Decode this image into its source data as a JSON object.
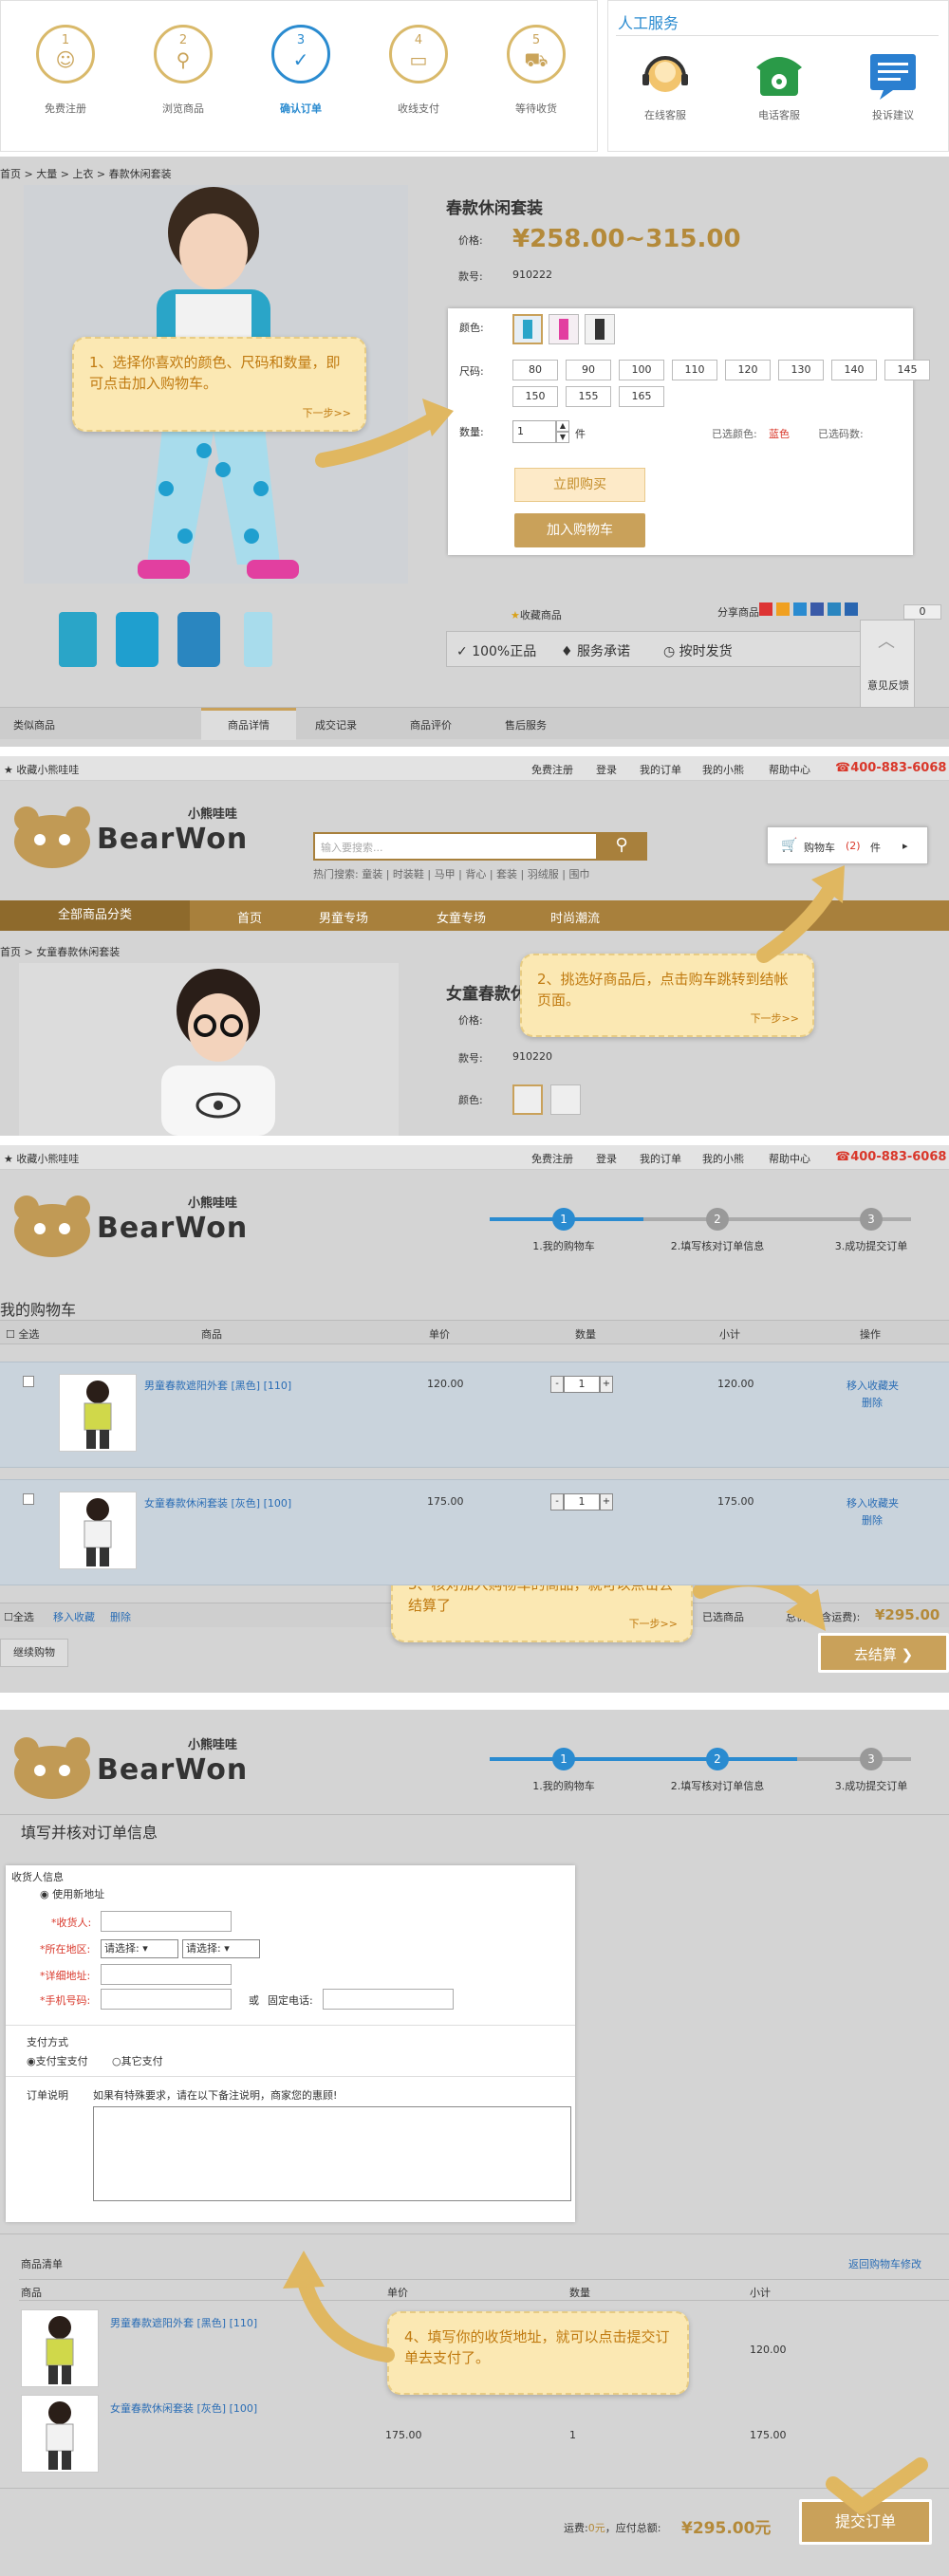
{
  "steps": [
    {
      "num": "1",
      "label": "免费注册"
    },
    {
      "num": "2",
      "label": "浏览商品"
    },
    {
      "num": "3",
      "label": "确认订单"
    },
    {
      "num": "4",
      "label": "收线支付"
    },
    {
      "num": "5",
      "label": "等待收货"
    }
  ],
  "service": {
    "title": "人工服务",
    "items": [
      "在线客服",
      "电话客服",
      "投诉建议"
    ]
  },
  "p1": {
    "breadcrumb": [
      "首页",
      "大量",
      "上衣",
      "春款休闲套装"
    ],
    "product_title": "春款休闲套装",
    "price_label": "价格:",
    "price": "¥258.00~315.00",
    "sku_label": "款号:",
    "sku": "910222",
    "color_label": "颜色:",
    "size_label": "尺码:",
    "sizes": [
      "80",
      "90",
      "100",
      "110",
      "120",
      "130",
      "140",
      "145",
      "150",
      "155",
      "165"
    ],
    "qty_label": "数量:",
    "qty": "1",
    "unit": "件",
    "chosen_color_label": "已选颜色:",
    "chosen_color": "蓝色",
    "chosen_size_label": "已选码数:",
    "buy_now": "立即购买",
    "add_cart": "加入购物车",
    "favorite": "收藏商品",
    "share": "分享商品",
    "share_count": "0",
    "guarantees": [
      "100%正品",
      "服务承诺",
      "按时发货"
    ],
    "feedback": "意见反馈",
    "tabs": [
      "类似商品",
      "商品详情",
      "成交记录",
      "商品评价",
      "售后服务"
    ],
    "note": "1、选择你喜欢的颜色、尺码和数量，即可点击加入购物车。",
    "note_next": "下一步>>"
  },
  "p2": {
    "topbar_left": "收藏小熊哇哇",
    "topbar_links": [
      "免费注册",
      "登录",
      "我的订单",
      "我的小熊",
      "帮助中心"
    ],
    "phone": "400-883-6068",
    "logo_cn": "小熊哇哇",
    "logo_en": "BearWon",
    "search_placeholder": "输入要搜索...",
    "hot_label": "热门搜索:",
    "hot": [
      "童装",
      "时装鞋",
      "马甲",
      "背心",
      "套装",
      "羽绒服",
      "围巾"
    ],
    "cart_label": "购物车",
    "cart_count": "(2)",
    "cart_unit": "件",
    "nav": [
      "全部商品分类",
      "首页",
      "男童专场",
      "女童专场",
      "时尚潮流"
    ],
    "breadcrumb": [
      "首页",
      "女童春款休闲套装"
    ],
    "product_title": "女童春款休闲套装",
    "price_label": "价格:",
    "sku_label": "款号:",
    "sku": "910220",
    "color_label": "颜色:",
    "note": "2、挑选好商品后，点击购车跳转到结帐页面。",
    "note_next": "下一步>>"
  },
  "p3": {
    "topbar_left": "收藏小熊哇哇",
    "topbar_links": [
      "免费注册",
      "登录",
      "我的订单",
      "我的小熊",
      "帮助中心"
    ],
    "phone": "400-883-6068",
    "progress": [
      {
        "num": "1",
        "label": "1.我的购物车"
      },
      {
        "num": "2",
        "label": "2.填写核对订单信息"
      },
      {
        "num": "3",
        "label": "3.成功提交订单"
      }
    ],
    "title": "我的购物车",
    "headers": [
      "全选",
      "商品",
      "单价",
      "数量",
      "小计",
      "操作"
    ],
    "items": [
      {
        "name": "男童春款遮阳外套 [黑色] [110]",
        "price": "120.00",
        "qty": "1",
        "subtotal": "120.00",
        "ops": [
          "移入收藏夹",
          "删除"
        ]
      },
      {
        "name": "女童春款休闲套装 [灰色] [100]",
        "price": "175.00",
        "qty": "1",
        "subtotal": "175.00",
        "ops": [
          "移入收藏夹",
          "删除"
        ]
      }
    ],
    "footer_select_all": "全选",
    "footer_move": "移入收藏",
    "footer_delete": "删除",
    "selected_label": "已选商品",
    "total_label": "总价(不含运费):",
    "total": "¥295.00",
    "continue": "继续购物",
    "checkout": "去结算",
    "note": "3、核对加入购物车的商品，就可以点击去结算了",
    "note_next": "下一步>>"
  },
  "p4": {
    "progress": [
      {
        "num": "1",
        "label": "1.我的购物车"
      },
      {
        "num": "2",
        "label": "2.填写核对订单信息"
      },
      {
        "num": "3",
        "label": "3.成功提交订单"
      }
    ],
    "title": "填写并核对订单信息",
    "consignee_title": "收货人信息",
    "use_new": "使用新地址",
    "name_label": "*收货人:",
    "region_label": "*所在地区:",
    "region_opts": [
      "请选择:",
      "请选择:"
    ],
    "address_label": "*详细地址:",
    "mobile_label": "*手机号码:",
    "or": "或",
    "tel_label": "固定电话:",
    "pay_title": "支付方式",
    "pay_opts": [
      "支付宝支付",
      "其它支付"
    ],
    "remark_label": "订单说明",
    "remark_hint": "如果有特殊要求，请在以下备注说明，商家您的惠顾!",
    "list_title": "商品清单",
    "back_link": "返回购物车修改",
    "list_headers": [
      "商品",
      "单价",
      "数量",
      "小计"
    ],
    "list_items": [
      {
        "name": "男童春款遮阳外套 [黑色] [110]",
        "price": "",
        "qty": "",
        "subtotal": "120.00"
      },
      {
        "name": "女童春款休闲套装 [灰色] [100]",
        "price": "175.00",
        "qty": "1",
        "subtotal": "175.00"
      }
    ],
    "freight_label": "运费:",
    "freight": "0元",
    "total_label": "应付总额:",
    "total": "¥295.00元",
    "submit": "提交订单",
    "note": "4、填写你的收货地址，就可以点击提交订单去支付了。"
  },
  "colors": {
    "gold": "#c9a15a",
    "blue": "#2a8bd0",
    "red": "#d9372a",
    "nav": "#a8803c"
  }
}
